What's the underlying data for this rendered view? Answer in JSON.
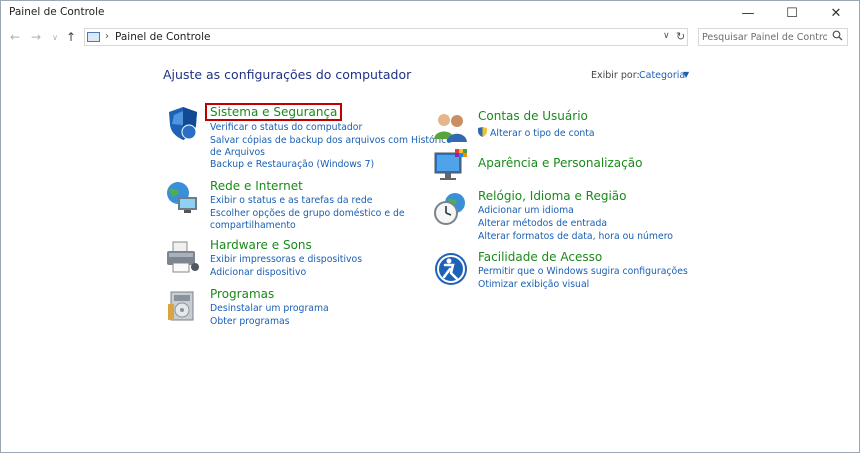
{
  "window": {
    "title": "Painel de Controle",
    "minimize": "—",
    "maximize": "☐",
    "close": "✕"
  },
  "nav": {
    "back": "←",
    "forward": "→",
    "recent": "∨",
    "up": "↑"
  },
  "address": {
    "separator": "›",
    "path": "Painel de Controle",
    "dropdown": "∨",
    "refresh": "↻"
  },
  "search": {
    "placeholder": "Pesquisar Painel de Controle",
    "icon": "search-icon"
  },
  "main": {
    "heading": "Ajuste as configurações do computador",
    "view_by_label": "Exibir por:",
    "view_by_value": "Categoria",
    "view_by_arrow": "▼"
  },
  "categories": {
    "system": {
      "title": "Sistema e Segurança",
      "links": [
        "Verificar o status do computador",
        "Salvar cópias de backup dos arquivos com Histórico",
        "de Arquivos",
        "Backup e Restauração (Windows 7)"
      ]
    },
    "network": {
      "title": "Rede e Internet",
      "links": [
        "Exibir o status e as tarefas da rede",
        "Escolher opções de grupo doméstico e de",
        "compartilhamento"
      ]
    },
    "hardware": {
      "title": "Hardware e Sons",
      "links": [
        "Exibir impressoras e dispositivos",
        "Adicionar dispositivo"
      ]
    },
    "programs": {
      "title": "Programas",
      "links": [
        "Desinstalar um programa",
        "Obter programas"
      ]
    },
    "accounts": {
      "title": "Contas de Usuário",
      "links": [
        "Alterar o tipo de conta"
      ]
    },
    "appearance": {
      "title": "Aparência e Personalização"
    },
    "clock": {
      "title": "Relógio, Idioma e Região",
      "links": [
        "Adicionar um idioma",
        "Alterar métodos de entrada",
        "Alterar formatos de data, hora ou número"
      ]
    },
    "ease": {
      "title": "Facilidade de Acesso",
      "links": [
        "Permitir que o Windows sugira configurações",
        "Otimizar exibição visual"
      ]
    }
  },
  "colors": {
    "category_title": "#1a8a1a",
    "link": "#1a5fb4",
    "heading": "#1e3287",
    "highlight_box": "#c00000"
  }
}
